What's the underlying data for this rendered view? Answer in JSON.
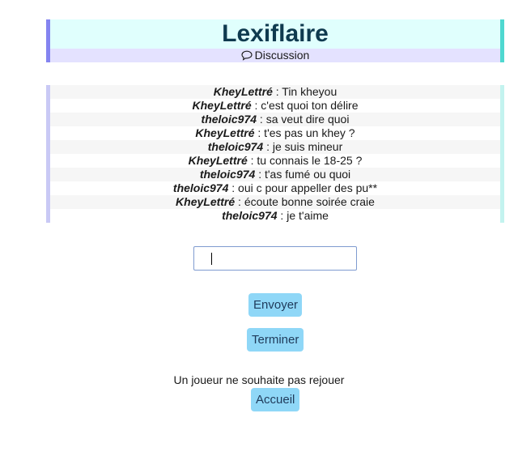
{
  "header": {
    "title": "Lexiflaire",
    "subtitle": "Discussion",
    "subtitle_icon": "speech-bubble-icon"
  },
  "chat": {
    "messages": [
      {
        "author": "KheyLettré",
        "text": " : Tin kheyou"
      },
      {
        "author": "KheyLettré",
        "text": " : c'est quoi ton délire"
      },
      {
        "author": "theloic974",
        "text": " : sa veut dire quoi"
      },
      {
        "author": "KheyLettré",
        "text": " : t'es pas un khey ?"
      },
      {
        "author": "theloic974",
        "text": " : je suis mineur"
      },
      {
        "author": "KheyLettré",
        "text": " : tu connais le 18-25 ?"
      },
      {
        "author": "theloic974",
        "text": " : t'as fumé ou quoi"
      },
      {
        "author": "theloic974",
        "text": " : oui c pour appeller des pu**"
      },
      {
        "author": "KheyLettré",
        "text": " : écoute bonne soirée craie"
      },
      {
        "author": "theloic974",
        "text": " : je t'aime"
      }
    ]
  },
  "form": {
    "input_value": "",
    "send_label": "Envoyer",
    "end_label": "Terminer"
  },
  "status": {
    "notice": "Un joueur ne souhaite pas rejouer",
    "home_label": "Accueil"
  },
  "colors": {
    "header_bg": "#e0fffd",
    "subtitle_bg": "#e4e2ff",
    "button_bg": "#8fd7f7",
    "title_color": "#0f3a4f"
  }
}
